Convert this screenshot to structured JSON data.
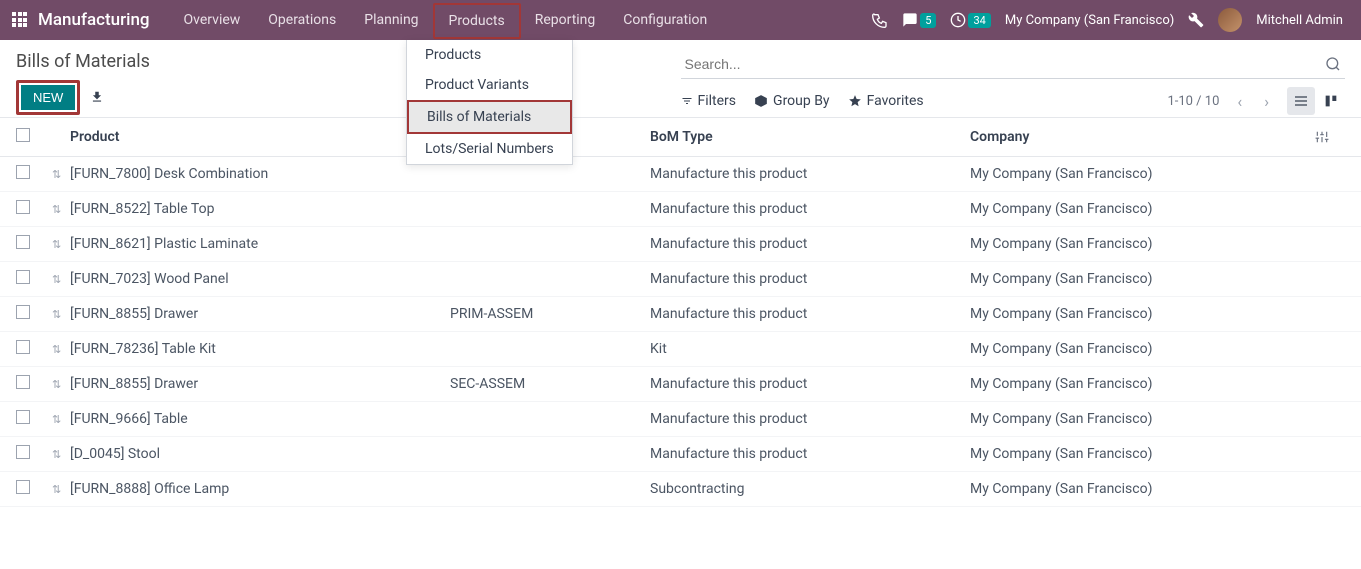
{
  "navbar": {
    "app_name": "Manufacturing",
    "items": [
      "Overview",
      "Operations",
      "Planning",
      "Products",
      "Reporting",
      "Configuration"
    ],
    "messages_badge": "5",
    "activities_badge": "34",
    "company": "My Company (San Francisco)",
    "username": "Mitchell Admin"
  },
  "dropdown": {
    "items": [
      "Products",
      "Product Variants",
      "Bills of Materials",
      "Lots/Serial Numbers"
    ]
  },
  "breadcrumb": "Bills of Materials",
  "new_btn": "NEW",
  "search": {
    "placeholder": "Search..."
  },
  "filters": {
    "filters_label": "Filters",
    "groupby_label": "Group By",
    "favorites_label": "Favorites"
  },
  "pager": "1-10 / 10",
  "columns": {
    "product": "Product",
    "bom_type": "BoM Type",
    "company": "Company"
  },
  "rows": [
    {
      "product": "[FURN_7800] Desk Combination",
      "ref": "",
      "type": "Manufacture this product",
      "company": "My Company (San Francisco)"
    },
    {
      "product": "[FURN_8522] Table Top",
      "ref": "",
      "type": "Manufacture this product",
      "company": "My Company (San Francisco)"
    },
    {
      "product": "[FURN_8621] Plastic Laminate",
      "ref": "",
      "type": "Manufacture this product",
      "company": "My Company (San Francisco)"
    },
    {
      "product": "[FURN_7023] Wood Panel",
      "ref": "",
      "type": "Manufacture this product",
      "company": "My Company (San Francisco)"
    },
    {
      "product": "[FURN_8855] Drawer",
      "ref": "PRIM-ASSEM",
      "type": "Manufacture this product",
      "company": "My Company (San Francisco)"
    },
    {
      "product": "[FURN_78236] Table Kit",
      "ref": "",
      "type": "Kit",
      "company": "My Company (San Francisco)"
    },
    {
      "product": "[FURN_8855] Drawer",
      "ref": "SEC-ASSEM",
      "type": "Manufacture this product",
      "company": "My Company (San Francisco)"
    },
    {
      "product": "[FURN_9666] Table",
      "ref": "",
      "type": "Manufacture this product",
      "company": "My Company (San Francisco)"
    },
    {
      "product": "[D_0045] Stool",
      "ref": "",
      "type": "Manufacture this product",
      "company": "My Company (San Francisco)"
    },
    {
      "product": "[FURN_8888] Office Lamp",
      "ref": "",
      "type": "Subcontracting",
      "company": "My Company (San Francisco)"
    }
  ]
}
